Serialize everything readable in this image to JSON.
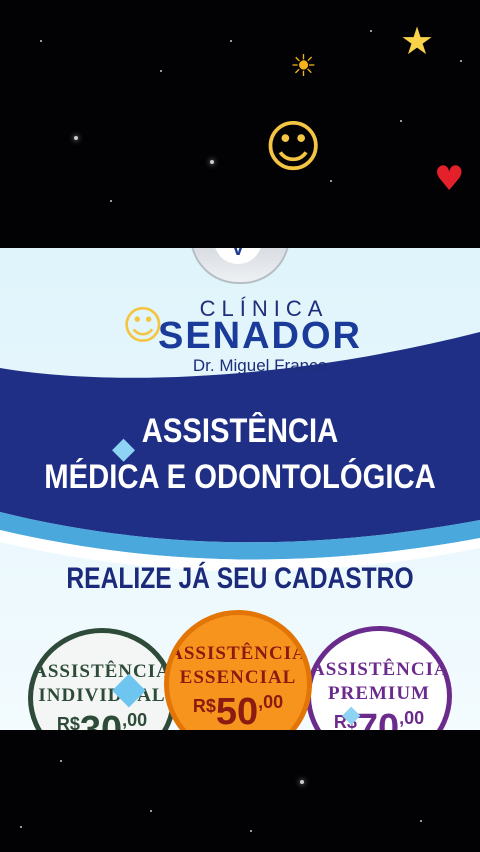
{
  "stickers": {
    "star": "★",
    "sun": "☀",
    "face": "☺",
    "heart": "♥",
    "diamond": "◆"
  },
  "poster": {
    "logo_letter": "V",
    "brand_top": "CLÍNICA",
    "brand_main": "SENADOR",
    "brand_sub": "Dr. Miguel Franco",
    "headline_1": "ASSISTÊNCIA",
    "headline_2": "MÉDICA E ODONTOLÓGICA",
    "cta": "REALIZE JÁ SEU CADASTRO",
    "plans": [
      {
        "name_1": "ASSISTÊNCIA",
        "name_2": "INDIVIDUAL",
        "currency": "R$",
        "amount": "30",
        "cents": ",00"
      },
      {
        "name_1": "ASSISTÊNCIA",
        "name_2": "ESSENCIAL",
        "currency": "R$",
        "amount": "50",
        "cents": ",00"
      },
      {
        "name_1": "ASSISTÊNCIA",
        "name_2": "PREMIUM",
        "currency": "R$",
        "amount": "70",
        "cents": ",00"
      }
    ]
  },
  "colors": {
    "navy": "#1b2a7a",
    "wave_blue": "#1f2f86",
    "light_blue": "#4aa8dc",
    "orange": "#f7941e",
    "green": "#2e4a38",
    "purple": "#6b2b8c"
  }
}
